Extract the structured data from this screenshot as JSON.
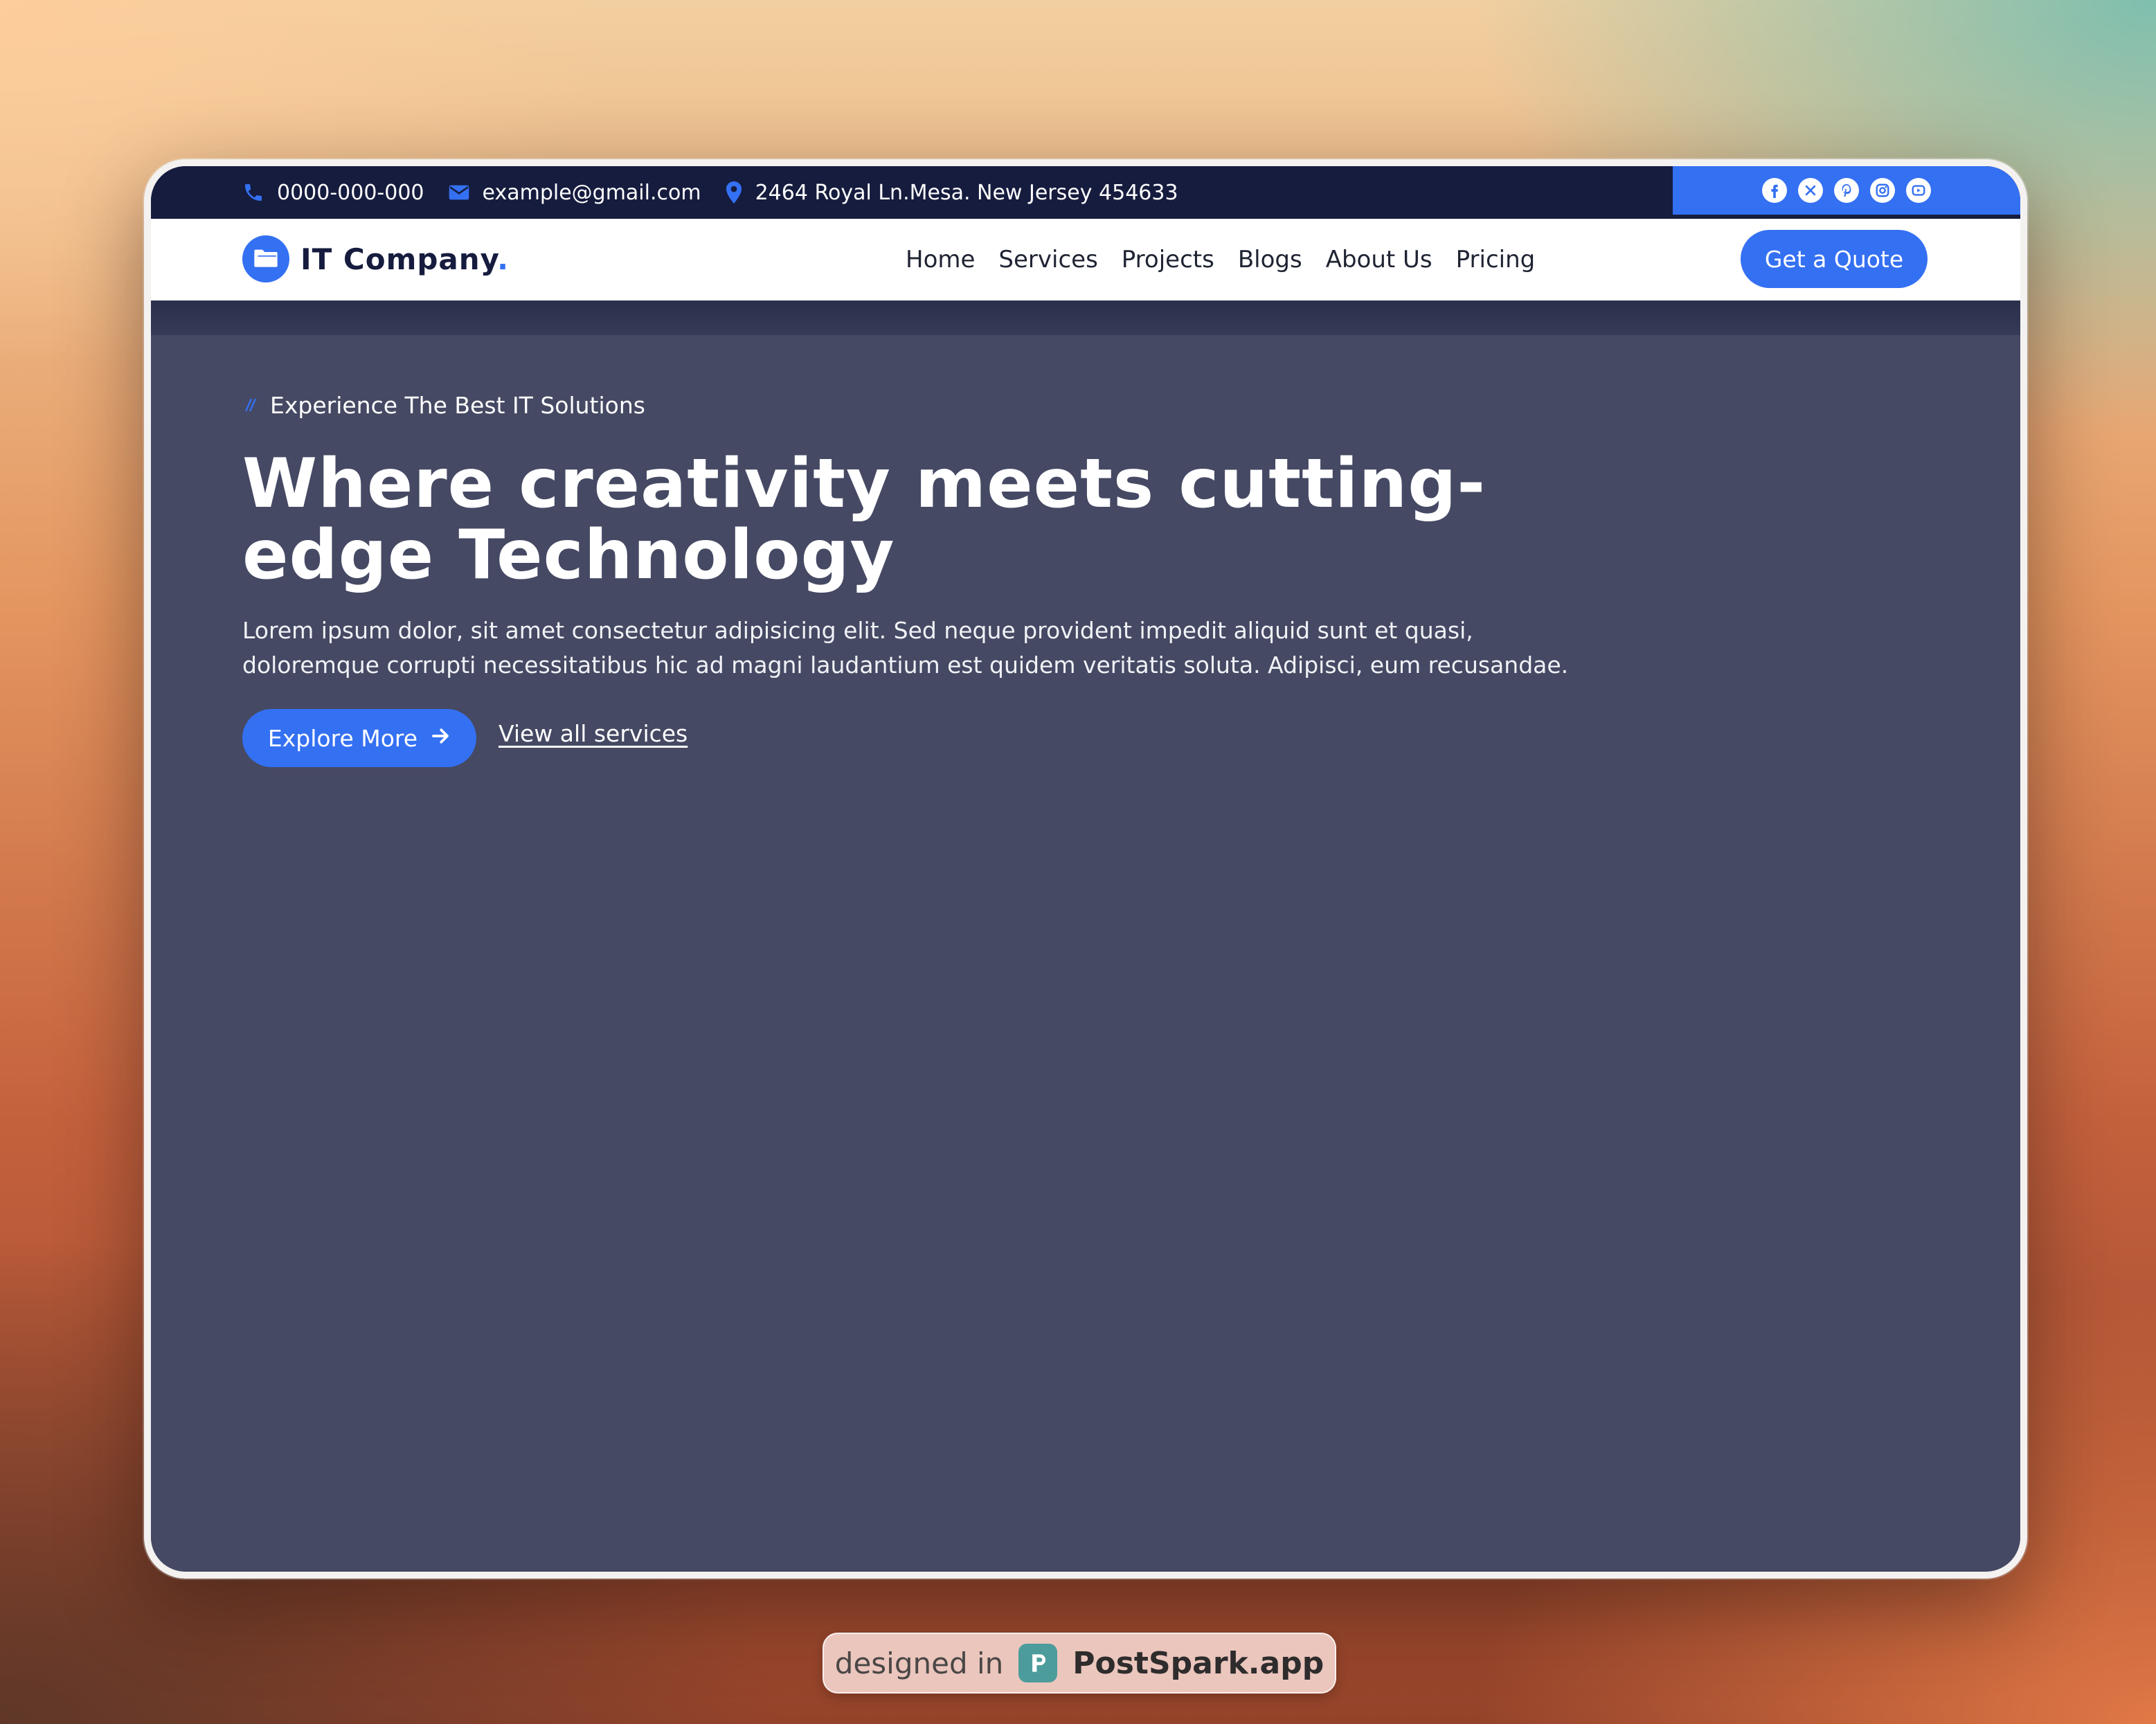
{
  "topbar": {
    "phone": "0000-000-000",
    "email": "example@gmail.com",
    "address": "2464 Royal Ln.Mesa. New Jersey 454633",
    "socials": [
      "facebook-icon",
      "x-icon",
      "pinterest-icon",
      "instagram-icon",
      "youtube-icon"
    ]
  },
  "brand": {
    "name": "IT Company",
    "dot": "."
  },
  "nav": {
    "items": [
      "Home",
      "Services",
      "Projects",
      "Blogs",
      "About Us",
      "Pricing"
    ],
    "cta": "Get a Quote"
  },
  "hero": {
    "eyebrow": "Experience The Best IT Solutions",
    "title_line1": "Where creativity meets cutting-",
    "title_line2": "edge Technology",
    "lead_line1": "Lorem ipsum dolor, sit amet consectetur adipisicing elit. Sed neque provident impedit aliquid sunt et quasi,",
    "lead_line2": "doloremque corrupti necessitatibus hic ad magni laudantium est quidem veritatis soluta. Adipisci, eum recusandae.",
    "primary_button": "Explore More",
    "secondary_link": "View all services"
  },
  "badge": {
    "prefix": "designed in",
    "brand": "PostSpark.app"
  },
  "colors": {
    "accent": "#3470f2",
    "navy": "#161c3e",
    "hero_bg": "#454963"
  }
}
